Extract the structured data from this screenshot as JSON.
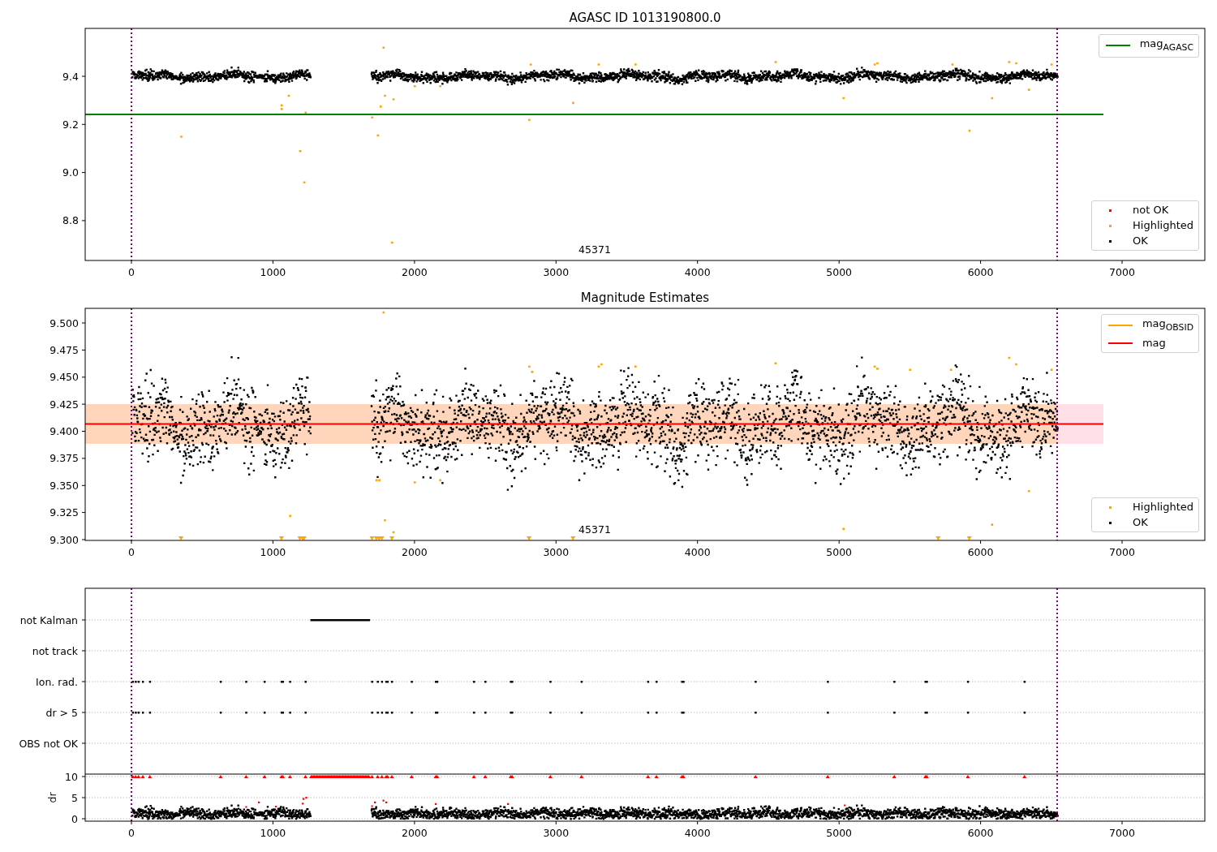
{
  "panels": [
    {
      "kind": "magnitude",
      "title": "AGASC ID 1013190800.0",
      "yticks": [
        "9.4",
        "9.2",
        "9.0",
        "8.8"
      ],
      "xticks": [
        "0",
        "1000",
        "2000",
        "3000",
        "4000",
        "5000",
        "6000",
        "7000"
      ],
      "annotation": "45371",
      "legends": [
        [
          {
            "kind": "line",
            "label": "mag$_{AGASC}$",
            "color": "#008000"
          }
        ],
        [
          {
            "kind": "dot",
            "label": "not OK",
            "color": "#ff0000"
          },
          {
            "kind": "dot",
            "label": "Highlighted",
            "color": "#ffa500"
          },
          {
            "kind": "dot",
            "label": "OK",
            "color": "#000000"
          }
        ]
      ]
    },
    {
      "kind": "magnitude",
      "title": "Magnitude Estimates",
      "yticks": [
        "9.500",
        "9.475",
        "9.450",
        "9.425",
        "9.400",
        "9.375",
        "9.350",
        "9.325",
        "9.300"
      ],
      "xticks": [
        "0",
        "1000",
        "2000",
        "3000",
        "4000",
        "5000",
        "6000",
        "7000"
      ],
      "annotation": "45371",
      "legends": [
        [
          {
            "kind": "line",
            "label": "mag$_{OBSID}$",
            "color": "#ffa500"
          },
          {
            "kind": "line",
            "label": "mag",
            "color": "#ff0000"
          }
        ],
        [
          {
            "kind": "dot",
            "label": "Highlighted",
            "color": "#ffa500"
          },
          {
            "kind": "dot",
            "label": "OK",
            "color": "#000000"
          }
        ]
      ]
    },
    {
      "kind": "flags",
      "rows": [
        "not Kalman",
        "not track",
        "Ion. rad.",
        "dr > 5",
        "OBS not OK"
      ],
      "ylabel": "dr",
      "yticks": [
        "10",
        "5",
        "0"
      ],
      "xticks": [
        "0",
        "1000",
        "2000",
        "3000",
        "4000",
        "5000",
        "6000",
        "7000"
      ]
    }
  ]
}
